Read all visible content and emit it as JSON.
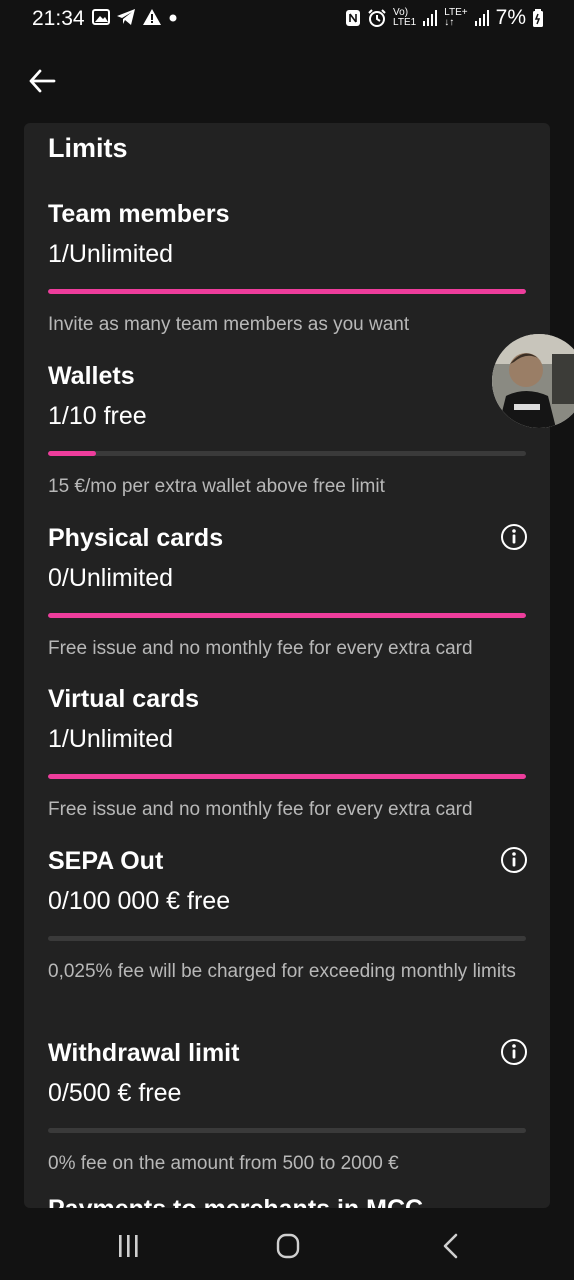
{
  "status_bar": {
    "time": "21:34",
    "network_label_1": "Vo)",
    "network_label_2": "LTE1",
    "network_label_3": "LTE+",
    "battery": "7%"
  },
  "colors": {
    "accent": "#ee3d9c",
    "track": "#3a3a3a",
    "card": "#222222",
    "background": "#121212"
  },
  "limits": {
    "title": "Limits",
    "items": [
      {
        "name": "Team members",
        "value": "1/Unlimited",
        "fill": 1.0,
        "description": "Invite as many team members as you want",
        "has_info": false
      },
      {
        "name": "Wallets",
        "value": "1/10 free",
        "fill": 0.1,
        "description": "15 €/mo per extra wallet above free limit",
        "has_info": false
      },
      {
        "name": "Physical cards",
        "value": "0/Unlimited",
        "fill": 1.0,
        "description": "Free issue and no monthly fee for every extra card",
        "has_info": true
      },
      {
        "name": "Virtual cards",
        "value": "1/Unlimited",
        "fill": 1.0,
        "description": "Free issue and no monthly fee for every extra card",
        "has_info": false
      },
      {
        "name": "SEPA Out",
        "value": "0/100 000 € free",
        "fill": 0.0,
        "description": "0,025% fee will be charged for exceeding monthly limits",
        "has_info": true
      },
      {
        "name": "Withdrawal limit",
        "value": "0/500 € free",
        "fill": 0.0,
        "description": "0% fee on the amount from 500 to 2000 €",
        "has_info": true
      }
    ],
    "next_item_partial": "Payments to merchants in MCC"
  },
  "icons": {
    "back": "arrow-left-icon",
    "info": "info-icon",
    "nav_recent": "recent-apps-icon",
    "nav_home": "home-icon",
    "nav_back": "nav-back-icon"
  }
}
